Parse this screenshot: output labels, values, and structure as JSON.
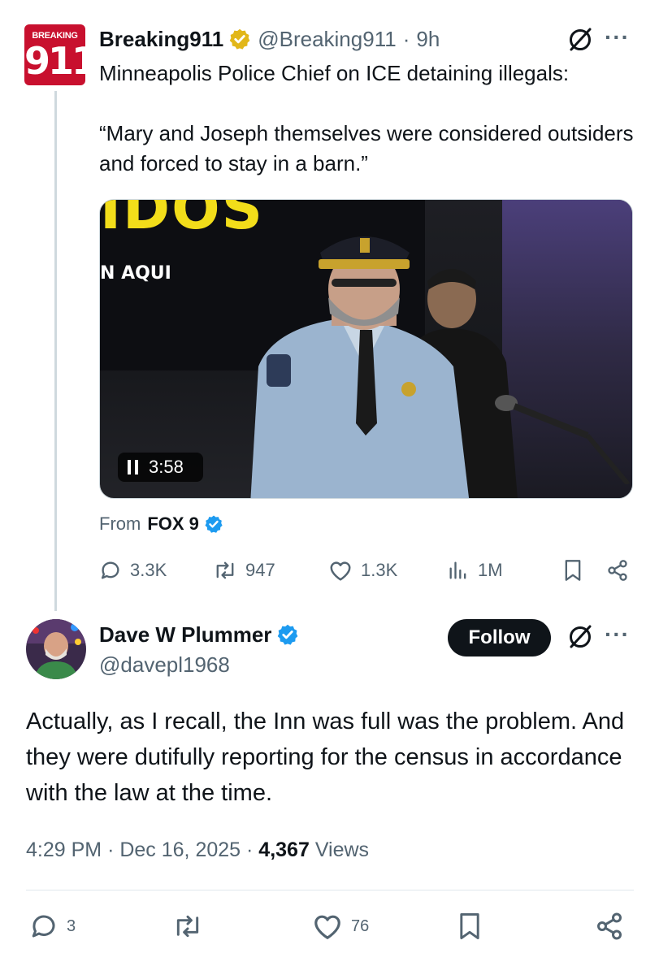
{
  "parent": {
    "avatar": {
      "top_text": "BREAKING",
      "number": "911"
    },
    "name": "Breaking911",
    "handle": "@Breaking911",
    "separator": "·",
    "time": "9h",
    "text_line1": "Minneapolis Police Chief on ICE detaining illegals:",
    "text_quote": "“Mary and Joseph themselves were considered outsiders and forced to stay in a barn.”",
    "media": {
      "sign_big": "IDOS",
      "sign_small": "N AQUI",
      "duration": "3:58"
    },
    "source_prefix": "From",
    "source_name": "FOX 9",
    "stats": {
      "replies": "3.3K",
      "reposts": "947",
      "likes": "1.3K",
      "views": "1M"
    },
    "more_label": "···"
  },
  "reply": {
    "name": "Dave W Plummer",
    "handle": "@davepl1968",
    "follow_label": "Follow",
    "more_label": "···",
    "text": "Actually, as I recall, the Inn was full was the problem.  And they were dutifully reporting for the census in accordance with the law at the time.",
    "time": "4:29 PM",
    "separator": "·",
    "date": "Dec 16, 2025",
    "views_count": "4,367",
    "views_label": "Views",
    "stats": {
      "replies": "3",
      "likes": "76"
    }
  },
  "colors": {
    "text": "#0f1419",
    "muted": "#536471",
    "verified_blue": "#1d9bf0",
    "verified_gold": "#e2b719",
    "brand_red": "#c8102e"
  },
  "icons": [
    "gold-verified-icon",
    "grok-icon",
    "more-icon",
    "pause-icon",
    "blue-verified-icon",
    "reply-icon",
    "repost-icon",
    "like-icon",
    "views-icon",
    "bookmark-icon",
    "share-icon"
  ]
}
